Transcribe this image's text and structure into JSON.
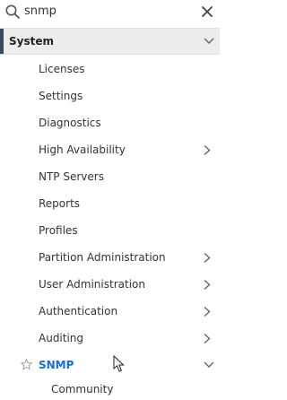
{
  "search": {
    "value": "snmp",
    "icon": "search-icon",
    "clear_icon": "close-icon"
  },
  "section": {
    "label": "System",
    "icon": "chevron-down-icon",
    "accent_color": "#3a4a5a"
  },
  "items": [
    {
      "label": "Licenses",
      "has_submenu": false
    },
    {
      "label": "Settings",
      "has_submenu": false
    },
    {
      "label": "Diagnostics",
      "has_submenu": false
    },
    {
      "label": "High Availability",
      "has_submenu": true
    },
    {
      "label": "NTP Servers",
      "has_submenu": false
    },
    {
      "label": "Reports",
      "has_submenu": false
    },
    {
      "label": "Profiles",
      "has_submenu": false
    },
    {
      "label": "Partition Administration",
      "has_submenu": true
    },
    {
      "label": "User Administration",
      "has_submenu": true
    },
    {
      "label": "Authentication",
      "has_submenu": true
    },
    {
      "label": "Auditing",
      "has_submenu": true
    }
  ],
  "snmp": {
    "label": "SNMP",
    "expanded": true,
    "color": "#1a6fc9",
    "favorite_icon": "star-icon"
  },
  "snmp_children": [
    {
      "label": "Community"
    }
  ]
}
